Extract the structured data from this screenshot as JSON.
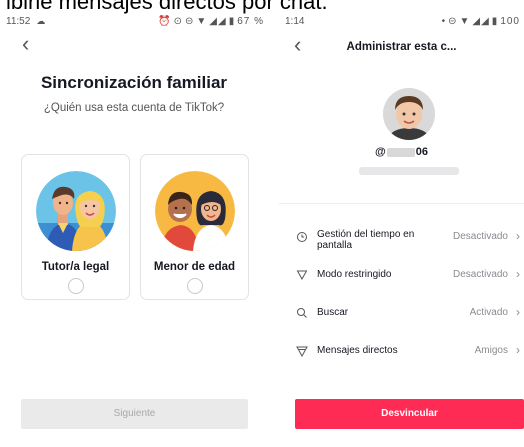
{
  "caption": "ibirie mensajes directos por chat.",
  "left": {
    "status": {
      "time": "11:52",
      "battery": "67 %"
    },
    "title": "Sincronización familiar",
    "subtitle": "¿Quién usa esta cuenta de TikTok?",
    "options": [
      {
        "label": "Tutor/a legal"
      },
      {
        "label": "Menor de edad"
      }
    ],
    "next_label": "Siguiente"
  },
  "right": {
    "status": {
      "time": "1:14",
      "battery": "100"
    },
    "title": "Administrar esta c...",
    "username_prefix": "@",
    "username_suffix": "06",
    "settings": [
      {
        "label": "Gestión del tiempo en pantalla",
        "value": "Desactivado",
        "icon": "clock-icon"
      },
      {
        "label": "Modo restringido",
        "value": "Desactivado",
        "icon": "filter-icon"
      },
      {
        "label": "Buscar",
        "value": "Activado",
        "icon": "search-icon"
      },
      {
        "label": "Mensajes directos",
        "value": "Amigos",
        "icon": "message-icon"
      }
    ],
    "unlink_label": "Desvincular"
  },
  "colors": {
    "accent": "#fe2c55",
    "disabled_button": "#eaeaeb",
    "text": "#161823",
    "muted": "#8a8b91"
  }
}
